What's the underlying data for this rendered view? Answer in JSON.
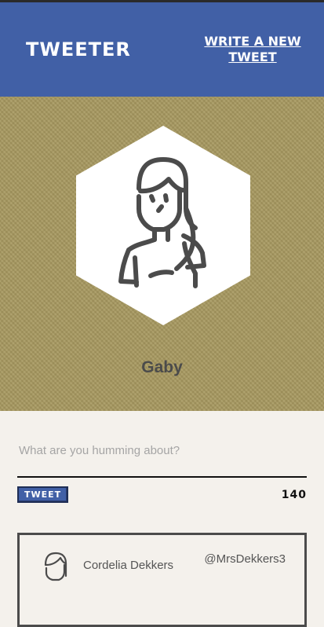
{
  "header": {
    "logo": "TWEETER",
    "write_link": "WRITE A NEW TWEET"
  },
  "profile": {
    "name": "Gaby",
    "avatar_icon": "woman-avatar-icon"
  },
  "composer": {
    "placeholder": "What are you humming about?",
    "value": "",
    "button_label": "TWEET",
    "char_count": "140"
  },
  "tweets": [
    {
      "name": "Cordelia Dekkers",
      "handle": "@MrsDekkers3",
      "avatar_icon": "woman-avatar-icon"
    }
  ],
  "colors": {
    "header_bg": "#4160a6",
    "hero_bg": "#a89960",
    "page_bg": "#f4f1ec",
    "icon_stroke": "#4b4b4b"
  }
}
